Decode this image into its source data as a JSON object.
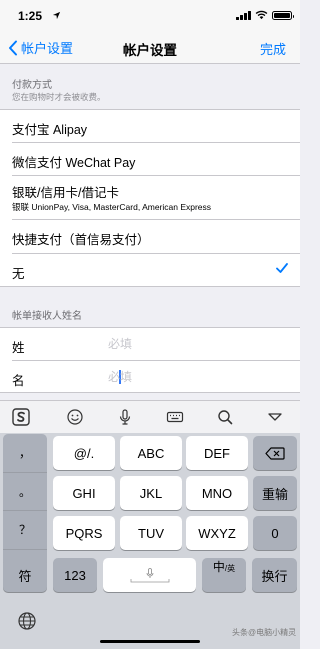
{
  "status_bar": {
    "time": "1:25"
  },
  "nav": {
    "back_label": "帐户设置",
    "title": "帐户设置",
    "done_label": "完成"
  },
  "payment": {
    "header": "付款方式",
    "subheader": "您在购物时才会被收费。",
    "options": [
      {
        "label": "支付宝 Alipay",
        "sub": "",
        "selected": false
      },
      {
        "label": "微信支付 WeChat Pay",
        "sub": "",
        "selected": false
      },
      {
        "label": "银联/信用卡/借记卡",
        "sub": "银联 UnionPay, Visa, MasterCard, American Express",
        "selected": false
      },
      {
        "label": "快捷支付（首信易支付）",
        "sub": "",
        "selected": false
      },
      {
        "label": "无",
        "sub": "",
        "selected": true
      }
    ]
  },
  "billing": {
    "header": "帐单接收人姓名",
    "last_name": {
      "label": "姓",
      "placeholder": "必填",
      "value": ""
    },
    "first_name": {
      "label": "名",
      "placeholder": "必填",
      "value": ""
    }
  },
  "keyboard": {
    "toolbar": [
      "sogou-logo-icon",
      "emoji-icon",
      "microphone-icon",
      "keyboard-icon",
      "search-icon",
      "collapse-icon"
    ],
    "side_keys": [
      "，",
      "。",
      "？",
      "！"
    ],
    "keys_row1": [
      {
        "main": "@/.",
        "sub": ""
      },
      {
        "main": "ABC",
        "sub": ""
      },
      {
        "main": "DEF",
        "sub": ""
      }
    ],
    "keys_row2": [
      {
        "main": "GHI",
        "sub": ""
      },
      {
        "main": "JKL",
        "sub": ""
      },
      {
        "main": "MNO",
        "sub": ""
      }
    ],
    "keys_row3": [
      {
        "main": "PQRS",
        "sub": ""
      },
      {
        "main": "TUV",
        "sub": ""
      },
      {
        "main": "WXYZ",
        "sub": ""
      }
    ],
    "reenter_label": "重输",
    "zero_label": "0",
    "symbol_label": "符",
    "num_label": "123",
    "lang_label_main": "中",
    "lang_label_sub": "/英",
    "return_label": "换行"
  },
  "watermark": "头条@电脑小精灵",
  "colors": {
    "accent": "#007aff",
    "caret": "#3478f6"
  }
}
